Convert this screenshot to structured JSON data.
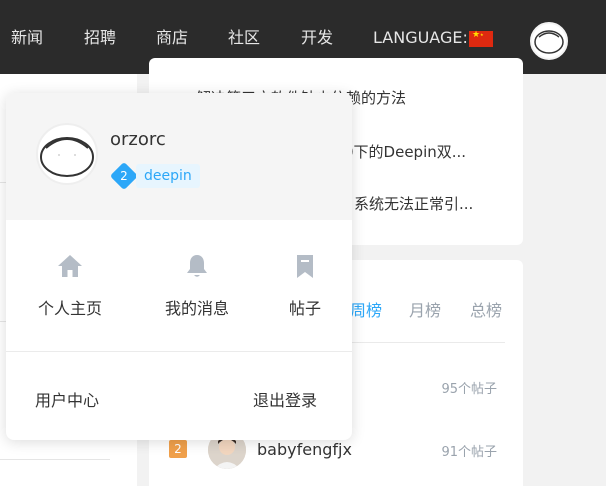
{
  "nav": {
    "items": [
      "新闻",
      "招聘",
      "商店",
      "社区",
      "开发"
    ],
    "language_label": "LANGUAGE:"
  },
  "articles": [
    "解决第三方软件缺少依赖的方法",
    "0下的Deepin双...",
    "系统无法正常引..."
  ],
  "ranking": {
    "tabs": [
      "周榜",
      "月榜",
      "总榜"
    ],
    "active_tab": "周榜",
    "entries": [
      {
        "count": "95个帖子"
      },
      {
        "rank": "2",
        "name": "babyfengfjx",
        "count": "91个帖子"
      }
    ]
  },
  "popup": {
    "username": "orzorc",
    "level": "2",
    "tag": "deepin",
    "quick_links": [
      {
        "label": "个人主页",
        "icon": "home-icon"
      },
      {
        "label": "我的消息",
        "icon": "bell-icon"
      },
      {
        "label": "帖子",
        "icon": "bookmark-icon"
      }
    ],
    "user_center": "用户中心",
    "logout": "退出登录"
  },
  "colors": {
    "nav_bg": "#2b2b2b",
    "accent": "#2ca7f8",
    "icon_gray": "#b4bcc6",
    "rank_badge": "#f0a04b"
  }
}
